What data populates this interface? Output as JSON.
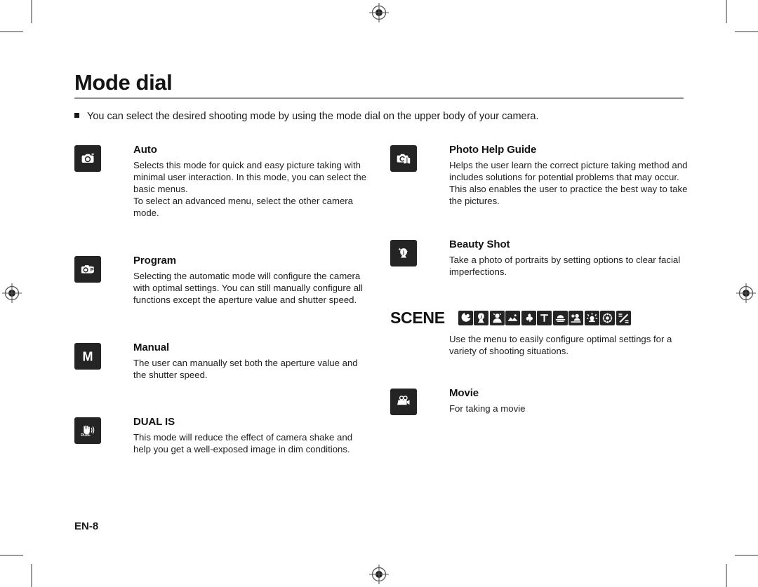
{
  "page": {
    "title": "Mode dial",
    "intro": "You can select the desired shooting mode by using the mode dial on the upper body of your camera.",
    "page_number": "EN-8",
    "ink_color": "#242424",
    "rule_color": "#8e8e8e",
    "crop_mark_color": "#9a9a9a"
  },
  "left_column": [
    {
      "icon": "camera-icon",
      "heading": "Auto",
      "description": "Selects this mode for quick and easy picture taking with minimal user interaction. In this mode, you can select the basic menus.\nTo select an advanced menu, select the other camera mode."
    },
    {
      "icon": "camera-program-icon",
      "heading": "Program",
      "description": "Selecting the automatic mode will configure the camera with optimal settings. You can still manually configure all functions except the aperture value and shutter speed."
    },
    {
      "icon": "letter-m-icon",
      "heading": "Manual",
      "description": "The user can manually set both the aperture value and the shutter speed."
    },
    {
      "icon": "dual-is-hand-icon",
      "heading": "DUAL IS",
      "description": "This mode will reduce the effect of camera shake and help you get a well-exposed image in dim conditions."
    }
  ],
  "right_column": [
    {
      "icon": "camera-help-guide-icon",
      "heading": "Photo Help Guide",
      "description": "Helps the user learn the correct picture taking method and includes solutions for potential problems that may occur. This also enables the user to practice the best way to take the pictures."
    },
    {
      "icon": "beauty-shot-face-icon",
      "heading": "Beauty Shot",
      "description": "Take a photo of portraits by setting options to clear facial imperfections."
    },
    {
      "icon": "movie-camera-icon",
      "heading": "Movie",
      "description": "For taking a movie"
    }
  ],
  "scene": {
    "label": "SCENE",
    "description": "Use the menu to easily configure optimal settings for a variety of shooting situations.",
    "icons": [
      "night-icon",
      "portrait-icon",
      "children-icon",
      "landscape-icon",
      "close-up-icon",
      "text-icon",
      "sunset-icon",
      "dawn-icon",
      "backlight-icon",
      "fireworks-icon",
      "beach-and-snow-icon"
    ]
  }
}
